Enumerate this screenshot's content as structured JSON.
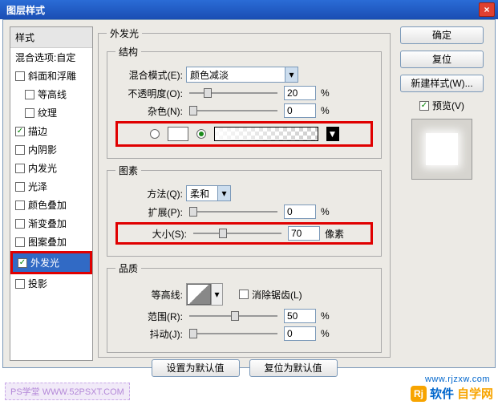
{
  "window": {
    "title": "图层样式",
    "close": "×"
  },
  "left": {
    "header": "样式",
    "blend_defaults": "混合选项:自定",
    "items": [
      {
        "k": "bevel",
        "label": "斜面和浮雕",
        "checked": false
      },
      {
        "k": "contour_sub",
        "label": "等高线",
        "checked": false,
        "sub": true
      },
      {
        "k": "texture_sub",
        "label": "纹理",
        "checked": false,
        "sub": true
      },
      {
        "k": "stroke",
        "label": "描边",
        "checked": true
      },
      {
        "k": "inner_shadow",
        "label": "内阴影",
        "checked": false
      },
      {
        "k": "inner_glow",
        "label": "内发光",
        "checked": false
      },
      {
        "k": "satin",
        "label": "光泽",
        "checked": false
      },
      {
        "k": "color_overlay",
        "label": "颜色叠加",
        "checked": false
      },
      {
        "k": "grad_overlay",
        "label": "渐变叠加",
        "checked": false
      },
      {
        "k": "pattern_overlay",
        "label": "图案叠加",
        "checked": false
      },
      {
        "k": "outer_glow",
        "label": "外发光",
        "checked": true
      },
      {
        "k": "drop_shadow",
        "label": "投影",
        "checked": false
      }
    ]
  },
  "main": {
    "section_title": "外发光",
    "group_struct": "结构",
    "blend_mode_label": "混合模式(E):",
    "blend_mode_value": "颜色减淡",
    "opacity_label": "不透明度(O):",
    "opacity_value": "20",
    "opacity_unit": "%",
    "noise_label": "杂色(N):",
    "noise_value": "0",
    "noise_unit": "%",
    "group_elements": "图素",
    "technique_label": "方法(Q):",
    "technique_value": "柔和",
    "spread_label": "扩展(P):",
    "spread_value": "0",
    "spread_unit": "%",
    "size_label": "大小(S):",
    "size_value": "70",
    "size_unit": "像素",
    "group_quality": "品质",
    "contour_label": "等高线:",
    "anti_alias_label": "消除锯齿(L)",
    "range_label": "范围(R):",
    "range_value": "50",
    "range_unit": "%",
    "jitter_label": "抖动(J):",
    "jitter_value": "0",
    "jitter_unit": "%",
    "btn_set_default": "设置为默认值",
    "btn_reset_default": "复位为默认值"
  },
  "right": {
    "ok": "确定",
    "reset": "复位",
    "new_style": "新建样式(W)...",
    "preview": "预览(V)"
  },
  "watermarks": {
    "left": "PS学堂  WWW.52PSXT.COM",
    "logo_letter": "Rj",
    "brand1": "软件",
    "brand2": "自学网",
    "url": "www.rjzxw.com"
  }
}
